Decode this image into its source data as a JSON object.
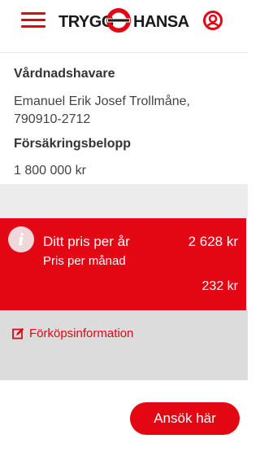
{
  "header": {
    "logo_left": "TRYGG",
    "logo_right": "HANSA"
  },
  "details": {
    "guardian_label": "Vårdnadshavare",
    "guardian_name": "Emanuel Erik Josef Trollmåne,",
    "guardian_id": "790910-2712",
    "insurance_amount_label": "Försäkringsbelopp",
    "insurance_amount_value": "1 800 000 kr"
  },
  "price": {
    "info_icon": "i",
    "title": "Ditt pris per år",
    "year_value": "2 628 kr",
    "month_label": "Pris per månad",
    "month_value": "232 kr"
  },
  "prepurchase": {
    "icon": "edit-icon",
    "label": "Förköpsinformation"
  },
  "apply_button": "Ansök här",
  "colors": {
    "brand_red": "#e30613",
    "gray_light": "#ececec",
    "gray_lower": "#dcdcdc"
  }
}
